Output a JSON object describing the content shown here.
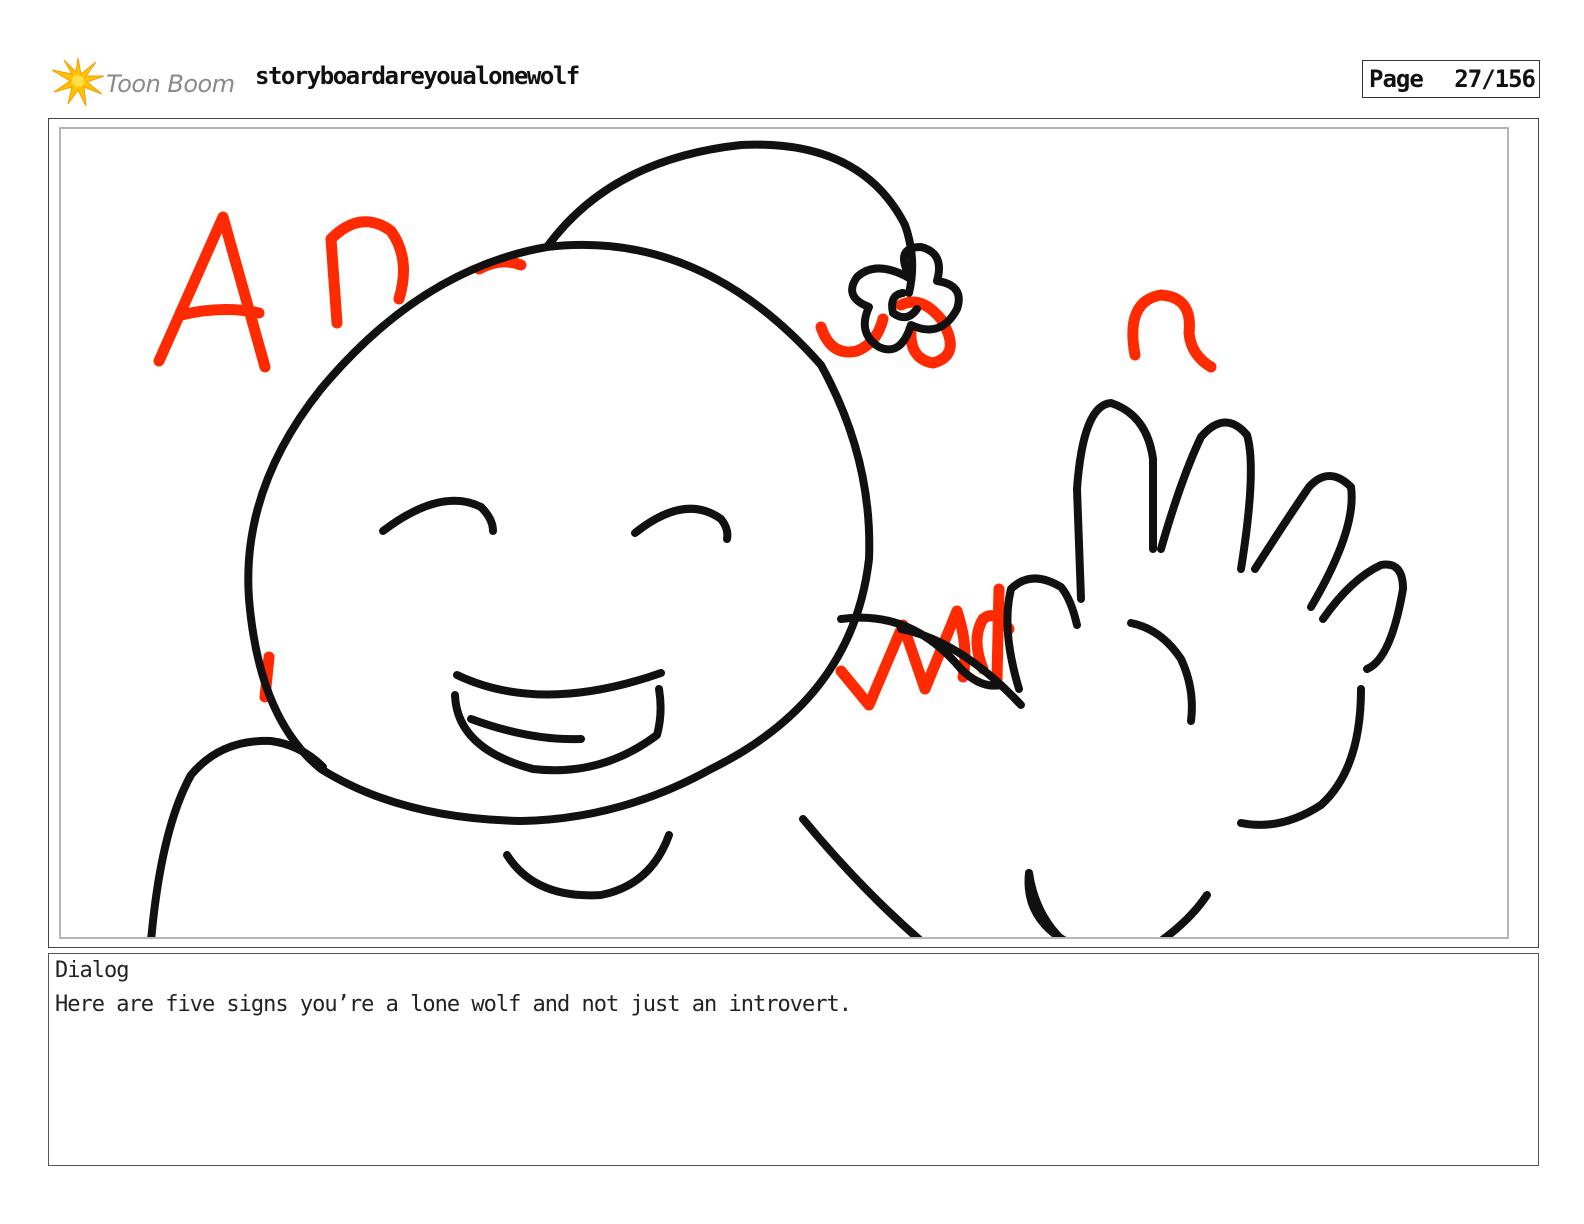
{
  "header": {
    "logo_text": "Toon Boom",
    "project_title": "storyboardareyoualonewolf",
    "page_label": "Page",
    "page_number": "27/156"
  },
  "panel": {
    "sketch_colors": {
      "ink": "#111111",
      "accent": "#ff2a00"
    }
  },
  "dialog": {
    "label": "Dialog",
    "text": "Here are five signs you’re a lone wolf and not just an introvert."
  }
}
